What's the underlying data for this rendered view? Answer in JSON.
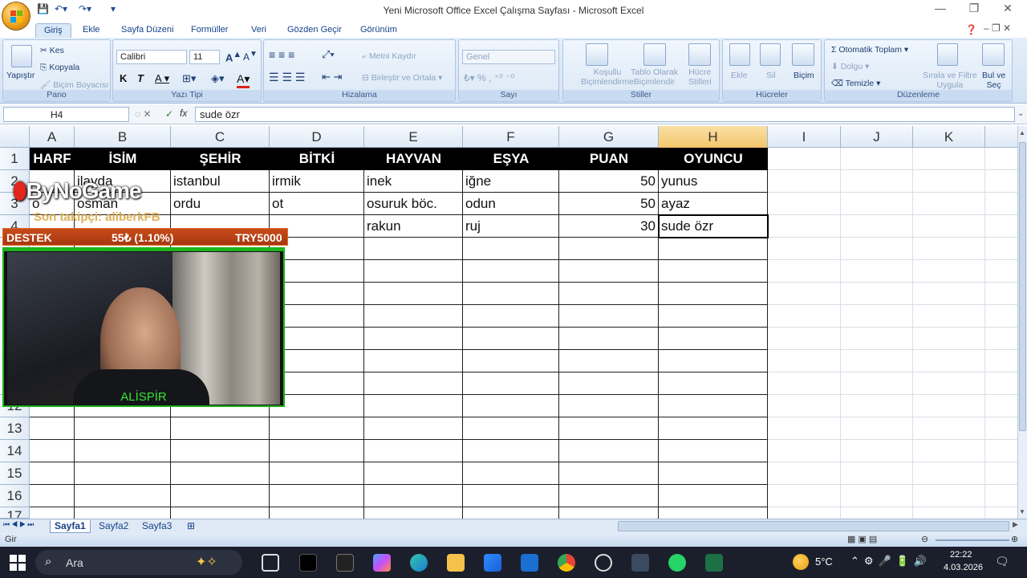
{
  "window": {
    "title": "Yeni Microsoft Office Excel Çalışma Sayfası - Microsoft Excel"
  },
  "tabs": [
    "Giriş",
    "Ekle",
    "Sayfa Düzeni",
    "Formüller",
    "Veri",
    "Gözden Geçir",
    "Görünüm"
  ],
  "ribbon": {
    "clipboard": {
      "label": "Pano",
      "paste": "Yapıştır",
      "cut": "Kes",
      "copy": "Kopyala",
      "format_painter": "Biçim Boyacısı"
    },
    "font": {
      "label": "Yazı Tipi",
      "name": "Calibri",
      "size": "11"
    },
    "alignment": {
      "label": "Hizalama",
      "wrap": "Metni Kaydır",
      "merge": "Birleştir ve Ortala"
    },
    "number": {
      "label": "Sayı",
      "format": "Genel"
    },
    "styles": {
      "label": "Stiller",
      "conditional": "Koşullu",
      "conditional2": "Biçimlendirme",
      "table": "Tablo Olarak",
      "table2": "Biçimlendir",
      "cell": "Hücre",
      "cell2": "Stilleri"
    },
    "cells": {
      "label": "Hücreler",
      "insert": "Ekle",
      "delete": "Sil",
      "format": "Biçim"
    },
    "editing": {
      "label": "Düzenleme",
      "autosum": "Otomatik Toplam",
      "fill": "Dolgu",
      "clear": "Temizle",
      "sort": "Sırala ve Filtre",
      "sort2": "Uygula",
      "find": "Bul ve",
      "find2": "Seç"
    }
  },
  "formula_bar": {
    "cell_ref": "H4",
    "fx": "fx",
    "content": "sude özr"
  },
  "columns": [
    "A",
    "B",
    "C",
    "D",
    "E",
    "F",
    "G",
    "H",
    "I",
    "J",
    "K"
  ],
  "rows": [
    "1",
    "2",
    "3",
    "4",
    "12",
    "13",
    "14",
    "15",
    "16",
    "17"
  ],
  "table": {
    "headers": [
      "HARF",
      "İSİM",
      "ŞEHİR",
      "BİTKİ",
      "HAYVAN",
      "EŞYA",
      "PUAN",
      "OYUNCU"
    ],
    "rows": [
      [
        "",
        "ilayda",
        "istanbul",
        "irmik",
        "inek",
        "iğne",
        "50",
        "yunus"
      ],
      [
        "o",
        "osman",
        "ordu",
        "ot",
        "osuruk böc.",
        "odun",
        "50",
        "ayaz"
      ],
      [
        "",
        "",
        "",
        "",
        "rakun",
        "ruj",
        "30",
        "sude özr"
      ]
    ]
  },
  "overlay": {
    "brand": "ByNoGame",
    "follower": "Son takipçi: aliberkFB",
    "support_label": "DESTEK",
    "support_progress": "55₺ (1.10%)",
    "support_goal": "TRY5000",
    "camera_name": "ALİSPİR"
  },
  "sheets": [
    "Sayfa1",
    "Sayfa2",
    "Sayfa3"
  ],
  "status": {
    "mode": "Gir"
  },
  "taskbar": {
    "search": "Ara",
    "weather": "5°C",
    "time": "22:22",
    "date": "4.03.2026"
  }
}
